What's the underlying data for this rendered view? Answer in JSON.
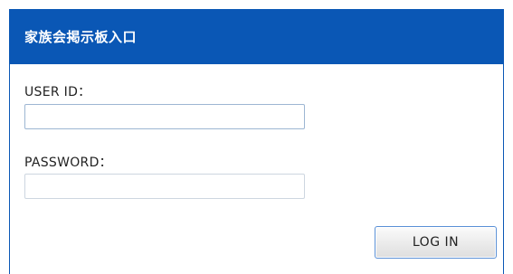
{
  "header": {
    "title": "家族会掲示板入口"
  },
  "form": {
    "user_id_label": "USER ID：",
    "user_id_value": "",
    "password_label": "PASSWORD：",
    "password_value": "",
    "login_button_label": "LOG IN"
  },
  "colors": {
    "header_background": "#0a57b5",
    "header_text": "#ffffff",
    "input_focus_border": "#9db6d3",
    "button_border": "#5a90d6"
  }
}
